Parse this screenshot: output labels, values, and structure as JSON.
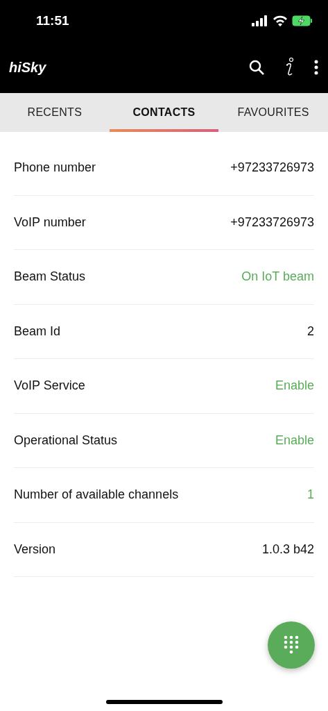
{
  "status_bar": {
    "time": "11:51"
  },
  "app_bar": {
    "logo": "hiSky"
  },
  "tabs": [
    {
      "label": "RECENTS",
      "selected": false
    },
    {
      "label": "CONTACTS",
      "selected": true
    },
    {
      "label": "FAVOURITES",
      "selected": false
    }
  ],
  "rows": [
    {
      "label": "Phone number",
      "value": "+97233726973",
      "color": "#111111"
    },
    {
      "label": "VoIP number",
      "value": "+97233726973",
      "color": "#111111"
    },
    {
      "label": "Beam Status",
      "value": "On IoT beam",
      "color": "#5aac5a"
    },
    {
      "label": "Beam Id",
      "value": "2",
      "color": "#111111"
    },
    {
      "label": "VoIP Service",
      "value": "Enable",
      "color": "#5aac5a"
    },
    {
      "label": "Operational Status",
      "value": "Enable",
      "color": "#5aac5a"
    },
    {
      "label": "Number of available channels",
      "value": "1",
      "color": "#5aac5a"
    },
    {
      "label": "Version",
      "value": "1.0.3 b42",
      "color": "#111111"
    }
  ]
}
